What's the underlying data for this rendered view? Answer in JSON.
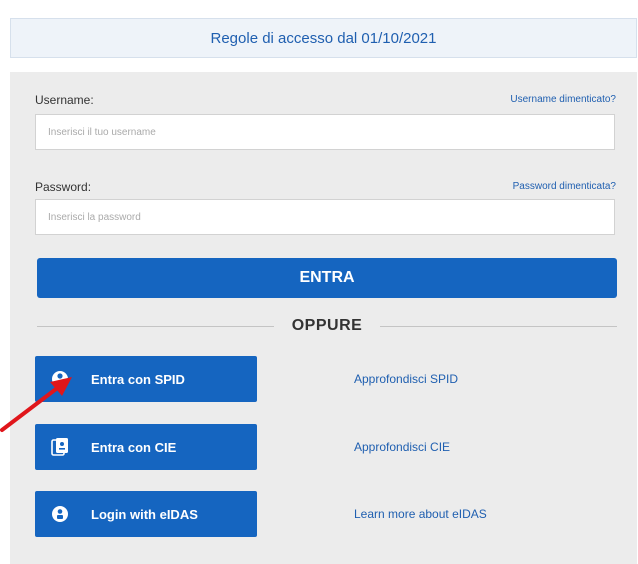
{
  "banner": {
    "text": "Regole di accesso dal 01/10/2021"
  },
  "form": {
    "username_label": "Username:",
    "username_forgot": "Username dimenticato?",
    "username_placeholder": "Inserisci il tuo username",
    "password_label": "Password:",
    "password_forgot": "Password dimenticata?",
    "password_placeholder": "Inserisci la password",
    "submit_label": "ENTRA"
  },
  "divider": {
    "text": "OPPURE"
  },
  "alt_logins": [
    {
      "label": "Entra con SPID",
      "icon": "spid-icon",
      "link": "Approfondisci SPID"
    },
    {
      "label": "Entra con CIE",
      "icon": "cie-icon",
      "link": "Approfondisci CIE"
    },
    {
      "label": "Login with eIDAS",
      "icon": "eidas-icon",
      "link": "Learn more about eIDAS"
    }
  ],
  "colors": {
    "primary": "#1565c0",
    "link": "#1f5fb0",
    "panel": "#ececec",
    "annotation_arrow": "#e0161b"
  }
}
